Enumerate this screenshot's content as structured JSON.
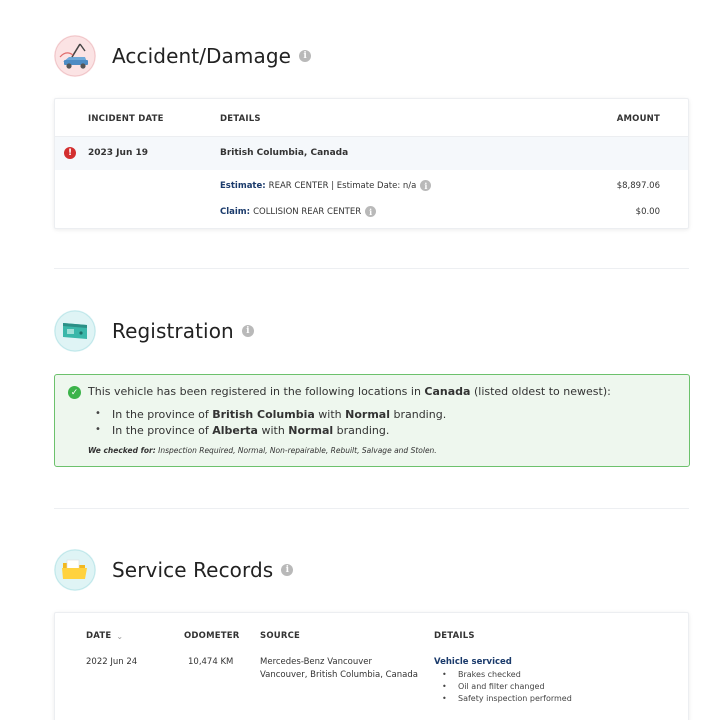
{
  "accident": {
    "title": "Accident/Damage",
    "icon": "tow-truck-icon",
    "headers": {
      "date": "INCIDENT DATE",
      "details": "DETAILS",
      "amount": "AMOUNT"
    },
    "incident": {
      "date": "2023 Jun 19",
      "location": "British Columbia, Canada",
      "estimate_label": "Estimate:",
      "estimate_text": "REAR CENTER | Estimate Date: n/a",
      "estimate_amount": "$8,897.06",
      "claim_label": "Claim:",
      "claim_text": "COLLISION REAR CENTER",
      "claim_amount": "$0.00"
    }
  },
  "registration": {
    "title": "Registration",
    "icon": "license-plate-icon",
    "intro_before": "This vehicle has been registered in the following locations in",
    "intro_country": "Canada",
    "intro_after": "(listed oldest to newest):",
    "entries": [
      {
        "prefix": "In the province of",
        "province": "British Columbia",
        "mid": "with",
        "branding": "Normal",
        "suffix": "branding."
      },
      {
        "prefix": "In the province of",
        "province": "Alberta",
        "mid": "with",
        "branding": "Normal",
        "suffix": "branding."
      }
    ],
    "checked_label": "We checked for:",
    "checked_text": "Inspection Required, Normal, Non-repairable, Rebuilt, Salvage and Stolen."
  },
  "service": {
    "title": "Service Records",
    "icon": "folder-icon",
    "headers": {
      "date": "DATE",
      "odometer": "ODOMETER",
      "source": "SOURCE",
      "details": "DETAILS"
    },
    "record": {
      "date": "2022 Jun 24",
      "odometer": "10,474 KM",
      "source_line1": "Mercedes-Benz Vancouver",
      "source_line2": "Vancouver, British Columbia, Canada",
      "detail_title": "Vehicle serviced",
      "items": [
        "Brakes checked",
        "Oil and filter changed",
        "Safety inspection performed"
      ]
    }
  },
  "colors": {
    "alert_red": "#d32f2f",
    "success_green": "#3bb34a",
    "link_blue": "#1a3a6b"
  }
}
